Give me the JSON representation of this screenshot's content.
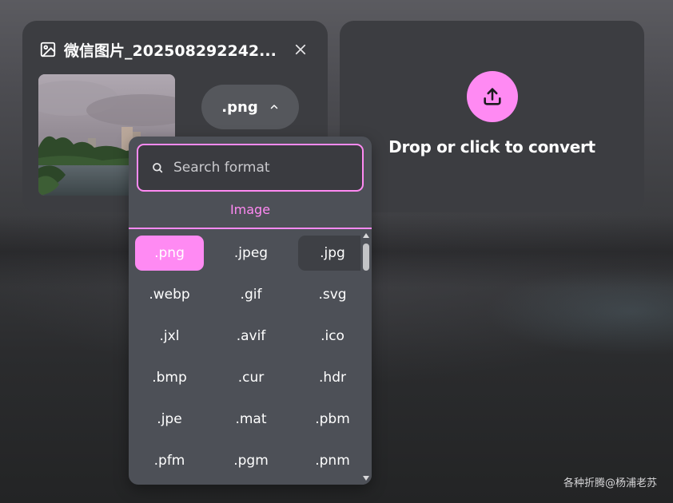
{
  "file": {
    "name": "微信图片_202508292242...",
    "selected_format": ".png"
  },
  "drop_zone": {
    "text": "Drop or click to convert"
  },
  "dropdown": {
    "search_placeholder": "Search format",
    "category": "Image",
    "formats": [
      ".png",
      ".jpeg",
      ".jpg",
      ".webp",
      ".gif",
      ".svg",
      ".jxl",
      ".avif",
      ".ico",
      ".bmp",
      ".cur",
      ".hdr",
      ".jpe",
      ".mat",
      ".pbm",
      ".pfm",
      ".pgm",
      ".pnm"
    ],
    "selected": ".png",
    "hovered": ".jpg"
  },
  "watermark": "各种折腾@杨浦老苏",
  "colors": {
    "accent": "#ff8af3",
    "card": "#3c3d41",
    "dropdown": "#4d5057"
  },
  "icons": {
    "file": "image-icon",
    "close": "close-icon",
    "format_toggle": "chevron-up-icon",
    "upload": "upload-icon",
    "search": "search-icon"
  }
}
